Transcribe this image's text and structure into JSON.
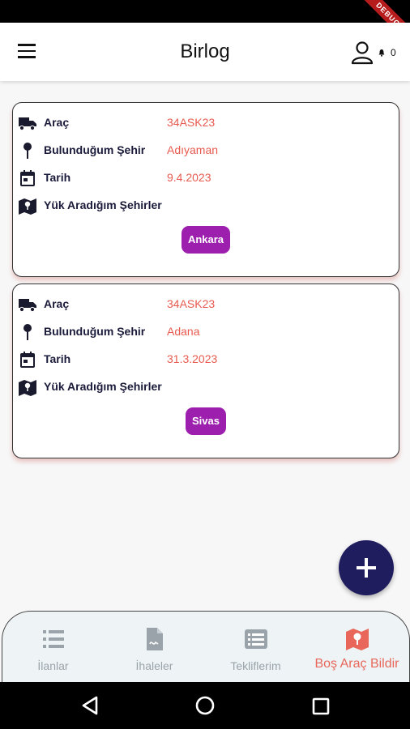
{
  "debug_banner": "DEBUG",
  "appbar": {
    "title": "Birlog",
    "notification_count": "0"
  },
  "cards": [
    {
      "vehicle_label": "Araç",
      "vehicle_value": "34ASK23",
      "location_label": "Bulunduğum Şehir",
      "location_value": "Adıyaman",
      "date_label": "Tarih",
      "date_value": "9.4.2023",
      "cities_label": "Yük Aradığım Şehirler",
      "cities": [
        "Ankara"
      ]
    },
    {
      "vehicle_label": "Araç",
      "vehicle_value": "34ASK23",
      "location_label": "Bulunduğum Şehir",
      "location_value": "Adana",
      "date_label": "Tarih",
      "date_value": "31.3.2023",
      "cities_label": "Yük Aradığım Şehirler",
      "cities": [
        "Sivas"
      ]
    }
  ],
  "bottom_nav": {
    "items": [
      {
        "label": "İlanlar",
        "icon": "list-icon"
      },
      {
        "label": "İhaleler",
        "icon": "document-icon"
      },
      {
        "label": "Tekliflerim",
        "icon": "offers-list-icon"
      },
      {
        "label": "Boş Araç Bildir",
        "icon": "map-icon",
        "active": true
      }
    ]
  },
  "colors": {
    "accent": "#e8675a",
    "chip": "#9c1fae",
    "fab": "#1f1d5e"
  }
}
